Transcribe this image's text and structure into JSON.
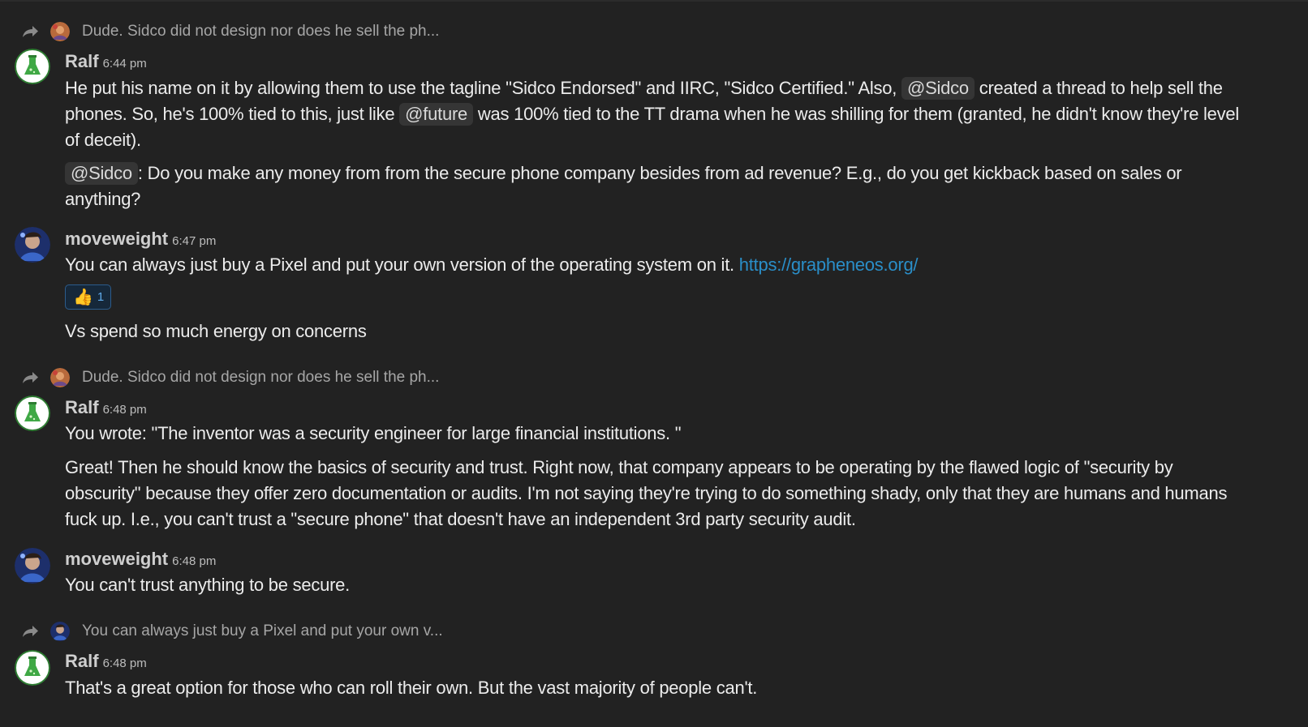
{
  "messages": [
    {
      "reply_preview": "Dude. Sidco did not design nor does he sell the ph...",
      "author": "Ralf",
      "time": "6:44 pm",
      "paragraphs": [
        {
          "l1a": "He put his name on it by allowing them to use the tagline \"Sidco Endorsed\" and IIRC, \"Sidco Certified.\" Also, ",
          "m1": "@Sidco",
          "l1b": " created a thread to help sell the",
          "l2a": "phones. So, he's 100% tied to this, just like ",
          "m2": "@future",
          "l2b": " was 100% tied to the TT drama when he was shilling for them (granted, he didn't know they're level",
          "l3": "of deceit)."
        },
        {
          "m1": "@Sidco",
          "l1b": ": Do you make any money from from the secure phone company besides from ad revenue? E.g., do you get kickback based on sales or",
          "l2": "anything?"
        }
      ]
    },
    {
      "author": "moveweight",
      "time": "6:47 pm",
      "text": "You can always just buy a Pixel and put your own version of the operating system on it. ",
      "link": "https://grapheneos.org/",
      "reaction": {
        "emoji": "👍",
        "count": "1"
      },
      "followup": "Vs spend so much energy on concerns"
    },
    {
      "reply_preview": "Dude. Sidco did not design nor does he sell the ph...",
      "author": "Ralf",
      "time": "6:48 pm",
      "p1": "You wrote: \"The inventor was a security engineer for large financial institutions. \"",
      "p2_l1": "Great! Then he should know the basics of security and trust. Right now, that company appears to be operating by the flawed logic of \"security by",
      "p2_l2": "obscurity\" because they offer zero documentation or audits. I'm not saying they're trying to do something shady, only that they are humans and humans",
      "p2_l3": "fuck up. I.e., you can't trust a \"secure phone\" that doesn't have an independent 3rd party security audit."
    },
    {
      "author": "moveweight",
      "time": "6:48 pm",
      "text": "You can't trust anything to be secure."
    },
    {
      "reply_preview": "You can always just buy a Pixel and put your own v...",
      "author": "Ralf",
      "time": "6:48 pm",
      "text": "That's a great option for those who can roll their own. But the vast majority of people can't."
    }
  ],
  "colors": {
    "background": "#222222",
    "link": "#2a8ec8",
    "mention_bg": "#353535",
    "reaction_border": "#2c5c8c"
  },
  "icons": [
    "reply-arrow-icon",
    "ralf-avatar",
    "moveweight-avatar",
    "thumbs-up-icon"
  ]
}
